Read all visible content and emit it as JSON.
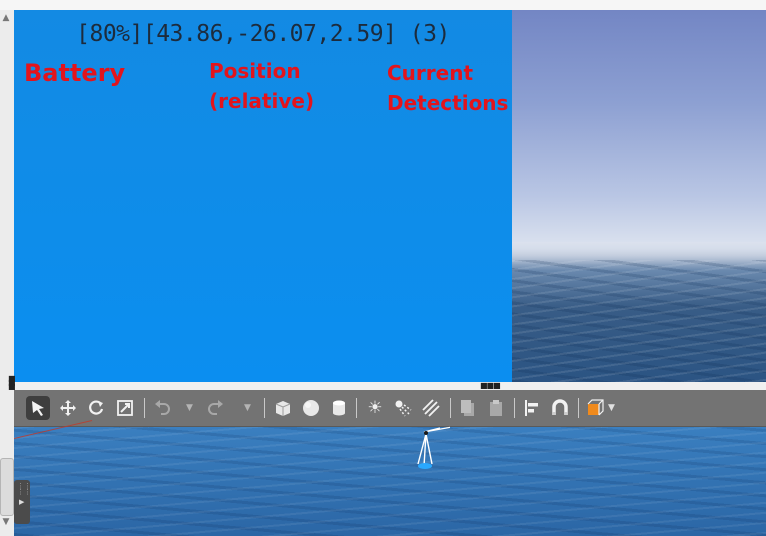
{
  "camera_hud": {
    "text": "[80%][43.86,-26.07,2.59] (3)",
    "battery_percent": 80,
    "position": [
      43.86,
      -26.07,
      2.59
    ],
    "detection_count": 3
  },
  "annotations": {
    "battery": "Battery",
    "position_line1": "Position",
    "position_line2": "(relative)",
    "detections_line1": "Current",
    "detections_line2": "Detections",
    "color": "#e3141c"
  },
  "toolbar": {
    "tools": [
      {
        "name": "select-icon",
        "glyph": "➤",
        "active": true
      },
      {
        "name": "translate-icon",
        "glyph": "✥"
      },
      {
        "name": "rotate-icon",
        "glyph": "↻"
      },
      {
        "name": "scale-icon",
        "glyph": "⤢"
      },
      {
        "name": "undo-icon",
        "glyph": "↶",
        "disabled": true
      },
      {
        "name": "redo-icon",
        "glyph": "↷",
        "disabled": true
      },
      {
        "name": "box-shape-icon",
        "glyph": "■"
      },
      {
        "name": "sphere-shape-icon",
        "glyph": "●"
      },
      {
        "name": "cylinder-shape-icon",
        "glyph": "▮"
      },
      {
        "name": "point-light-icon",
        "glyph": "☀"
      },
      {
        "name": "spot-light-icon",
        "glyph": "✺"
      },
      {
        "name": "directional-light-icon",
        "glyph": "⫽"
      },
      {
        "name": "copy-icon",
        "glyph": "❐",
        "disabled": true
      },
      {
        "name": "paste-icon",
        "glyph": "❏",
        "disabled": true
      },
      {
        "name": "align-icon",
        "glyph": "⊫"
      },
      {
        "name": "snap-magnet-icon",
        "glyph": "∩"
      },
      {
        "name": "view-angle-icon",
        "glyph": "◪"
      }
    ]
  },
  "colors": {
    "camera_bg": "#0e8dea",
    "toolbar_bg": "#737373",
    "ocean": "#2f6eb0",
    "view_angle_accent": "#f08a1c"
  }
}
